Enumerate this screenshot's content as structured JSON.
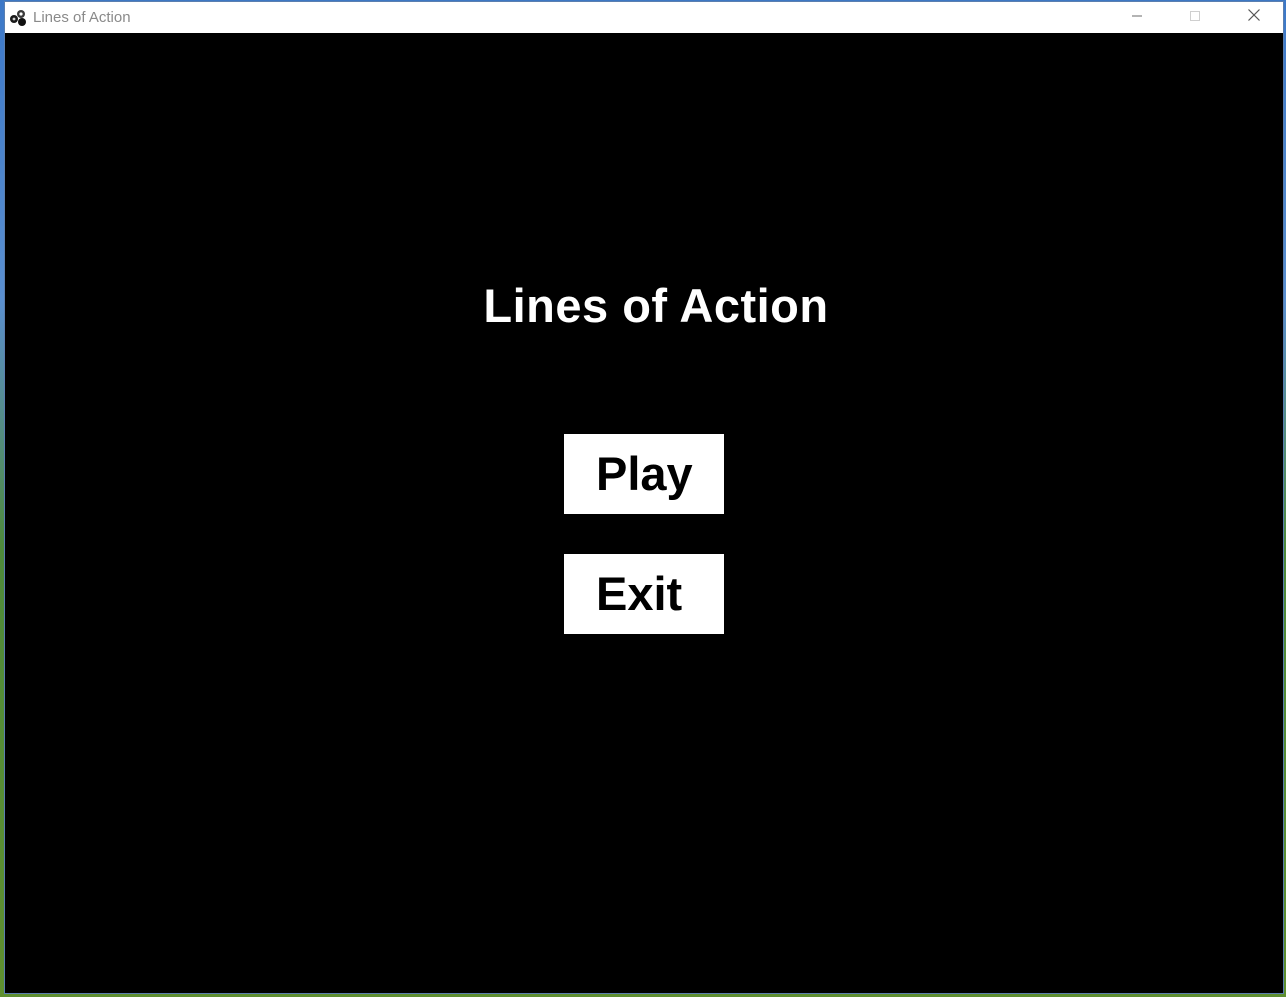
{
  "window": {
    "title": "Lines of Action",
    "controls": {
      "minimize_icon": "minimize-icon",
      "maximize_icon": "maximize-icon",
      "close_icon": "close-icon"
    }
  },
  "menu": {
    "title": "Lines of Action",
    "play_label": "Play",
    "exit_label": "Exit"
  },
  "colors": {
    "background": "#000000",
    "title_text": "#ffffff",
    "button_bg": "#ffffff",
    "button_text": "#000000"
  }
}
